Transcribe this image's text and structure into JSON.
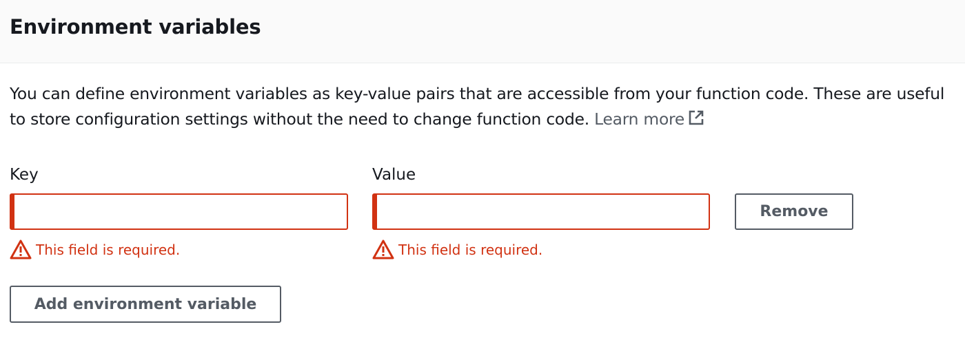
{
  "panel": {
    "title": "Environment variables",
    "description": "You can define environment variables as key-value pairs that are accessible from your function code. These are useful to store configuration settings without the need to change function code.",
    "learn_more": "Learn more"
  },
  "env_row": {
    "key_label": "Key",
    "key_value": "",
    "value_label": "Value",
    "value_value": "",
    "key_error": "This field is required.",
    "value_error": "This field is required.",
    "remove_label": "Remove"
  },
  "actions": {
    "add_label": "Add environment variable"
  },
  "icons": {
    "external_link": "external-link-icon",
    "warning": "warning-triangle-icon"
  },
  "colors": {
    "error": "#d13212",
    "button_text": "#545b64",
    "header_bg": "#fafafa"
  }
}
